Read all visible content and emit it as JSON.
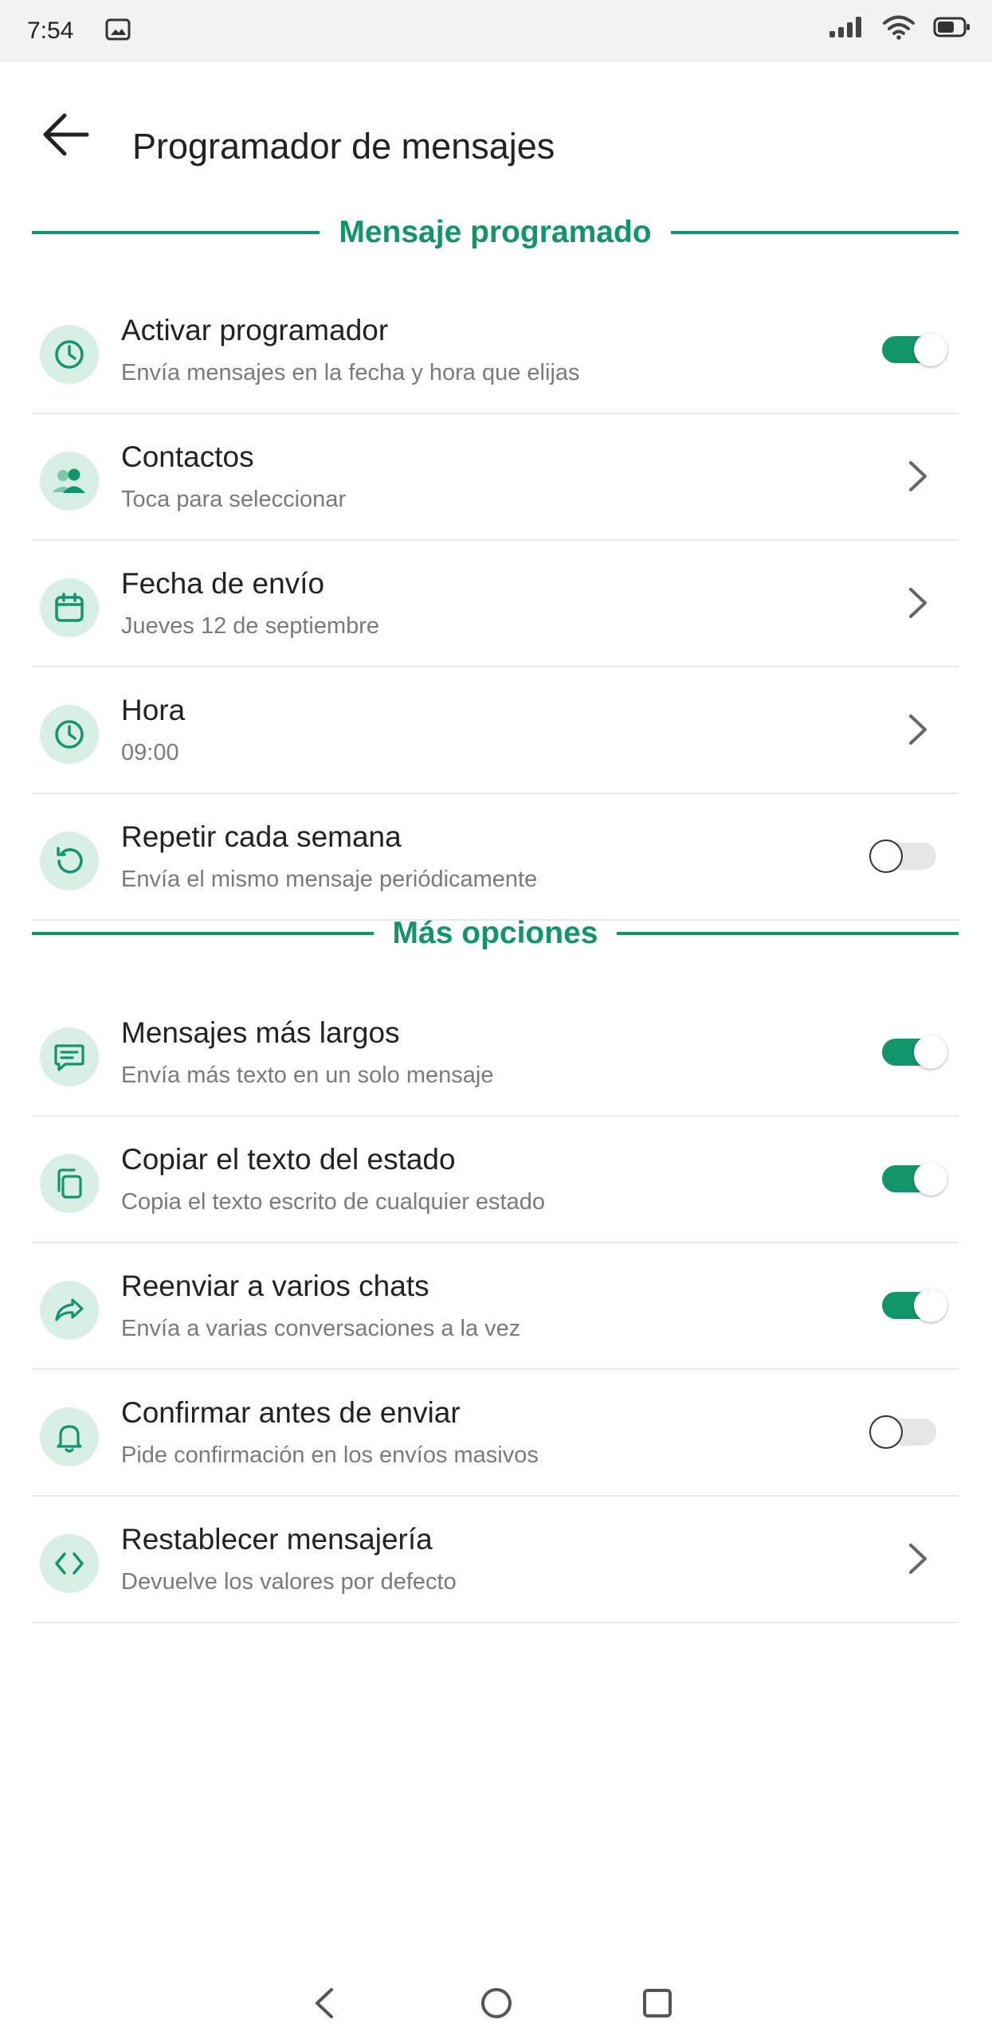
{
  "status_bar": {
    "time": "7:54"
  },
  "header": {
    "title": "Programador de mensajes",
    "back_icon": "arrow-left-icon"
  },
  "sections": {
    "scheduled": {
      "title": "Mensaje programado"
    },
    "more": {
      "title": "Más opciones"
    }
  },
  "items": {
    "activar": {
      "title": "Activar programador",
      "subtitle": "Envía mensajes en la fecha y hora que elijas",
      "icon": "clock-icon",
      "toggle": true
    },
    "contactos": {
      "title": "Contactos",
      "subtitle": "Toca para seleccionar",
      "icon": "contacts-icon"
    },
    "fecha": {
      "title": "Fecha de envío",
      "subtitle": "Jueves 12 de septiembre",
      "icon": "calendar-icon"
    },
    "hora": {
      "title": "Hora",
      "subtitle": "09:00",
      "icon": "clock-icon"
    },
    "repetir": {
      "title": "Repetir cada semana",
      "subtitle": "Envía el mismo mensaje periódicamente",
      "icon": "repeat-icon",
      "toggle": false
    },
    "largos": {
      "title": "Mensajes más largos",
      "subtitle": "Envía más texto en un solo mensaje",
      "icon": "message-icon",
      "toggle": true
    },
    "copiar": {
      "title": "Copiar el texto del estado",
      "subtitle": "Copia el texto escrito de cualquier estado",
      "icon": "copy-icon",
      "toggle": true
    },
    "reenviar": {
      "title": "Reenviar a varios chats",
      "subtitle": "Envía a varias conversaciones a la vez",
      "icon": "forward-icon",
      "toggle": true
    },
    "confirmar": {
      "title": "Confirmar antes de enviar",
      "subtitle": "Pide confirmación en los envíos masivos",
      "icon": "bell-icon",
      "toggle": false
    },
    "restablecer": {
      "title": "Restablecer mensajería",
      "subtitle": "Devuelve los valores por defecto",
      "icon": "code-icon"
    }
  },
  "colors": {
    "accent": "#12956d",
    "icon_bg": "#d8efe6",
    "divider": "#e9e9e9"
  }
}
